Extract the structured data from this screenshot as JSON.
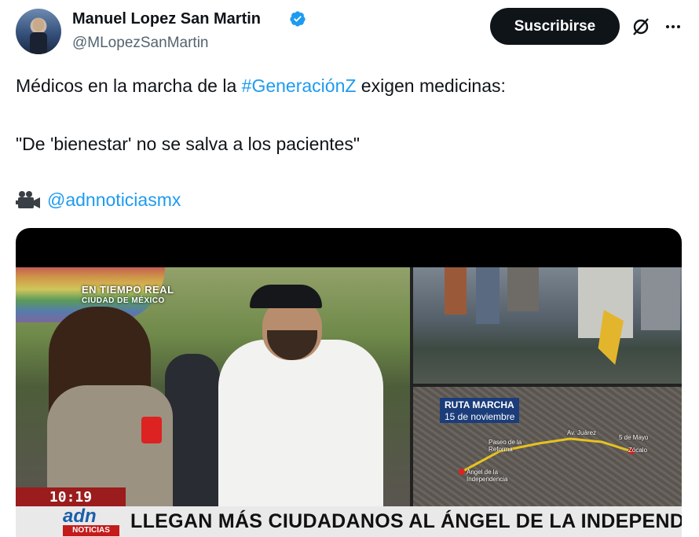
{
  "author": {
    "name": "Manuel Lopez San Martin",
    "handle": "@MLopezSanMartin"
  },
  "actions": {
    "subscribe_label": "Suscribirse"
  },
  "tweet": {
    "line1_before": "Médicos en la marcha de la ",
    "hashtag": "#GeneraciónZ",
    "line1_after": " exigen medicinas:",
    "quote": "\"De 'bienestar' no se salva a los pacientes\"",
    "credit_mention": "@adnnoticiasmx"
  },
  "video": {
    "live_label": "EN TIEMPO REAL",
    "live_location": "CIUDAD DE MÉXICO",
    "route_title": "RUTA MARCHA",
    "route_date": "15 de noviembre",
    "map_labels": {
      "juarez": "Av. Juárez",
      "cinco_mayo": "5 de Mayo",
      "paseo": "Paseo de la Reforma",
      "zocalo": "Zócalo",
      "angel": "Ángel de la Independencia"
    },
    "time": "10:19",
    "brand": "adn",
    "brand_sub": "NOTICIAS",
    "headline": "LLEGAN MÁS CIUDADANOS AL ÁNGEL DE LA INDEPENDENCIA"
  },
  "colors": {
    "link": "#1d9bf0",
    "verified": "#1d9bf0",
    "button_bg": "#0f1419"
  }
}
